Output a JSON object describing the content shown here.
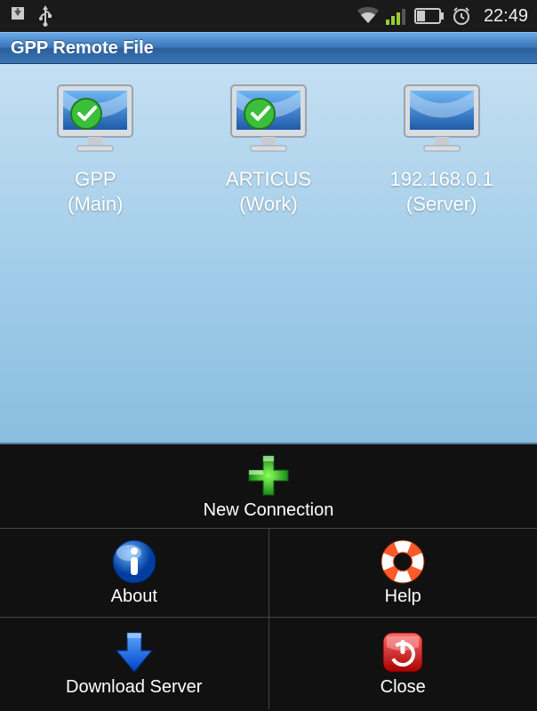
{
  "status": {
    "time": "22:49"
  },
  "title": "GPP Remote File",
  "connections": [
    {
      "name": "GPP",
      "tag": "(Main)",
      "online": true
    },
    {
      "name": "ARTICUS",
      "tag": "(Work)",
      "online": true
    },
    {
      "name": "192.168.0.1",
      "tag": "(Server)",
      "online": false
    }
  ],
  "menu": {
    "new_connection": "New Connection",
    "about": "About",
    "help": "Help",
    "download_server": "Download Server",
    "close": "Close"
  }
}
